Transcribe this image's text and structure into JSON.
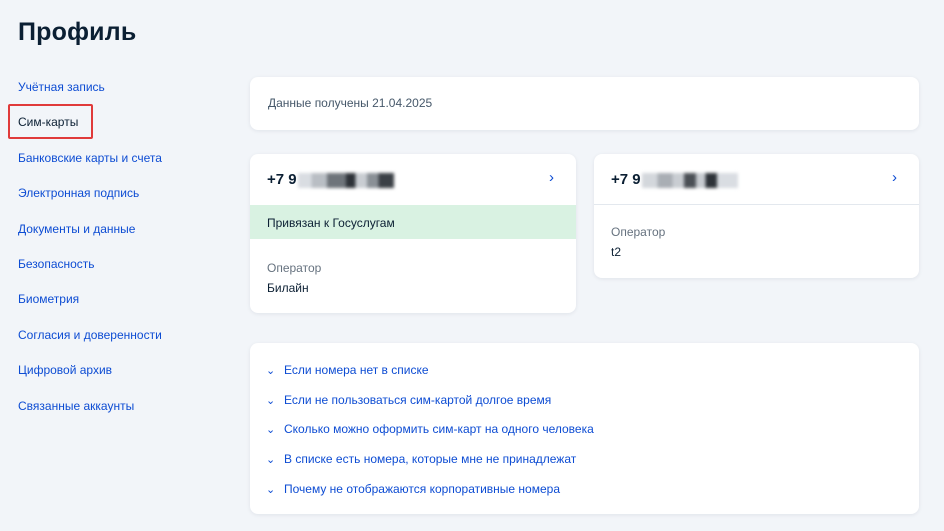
{
  "page": {
    "title": "Профиль"
  },
  "sidebar": {
    "items": [
      {
        "label": "Учётная запись"
      },
      {
        "label": "Сим-карты"
      },
      {
        "label": "Банковские карты и счета"
      },
      {
        "label": "Электронная подпись"
      },
      {
        "label": "Документы и данные"
      },
      {
        "label": "Безопасность"
      },
      {
        "label": "Биометрия"
      },
      {
        "label": "Согласия и доверенности"
      },
      {
        "label": "Цифровой архив"
      },
      {
        "label": "Связанные аккаунты"
      }
    ],
    "active": "Сим-карты"
  },
  "info": {
    "text": "Данные получены 21.04.2025"
  },
  "sims": [
    {
      "number_prefix": "+7 9",
      "bound_text": "Привязан к Госуслугам",
      "operator_label": "Оператор",
      "operator": "Билайн"
    },
    {
      "number_prefix": "+7 9",
      "operator_label": "Оператор",
      "operator": "t2"
    }
  ],
  "faq": [
    {
      "label": "Если номера нет в списке"
    },
    {
      "label": "Если не пользоваться сим-картой долгое время"
    },
    {
      "label": "Сколько можно оформить сим-карт на одного человека"
    },
    {
      "label": "В списке есть номера, которые мне не принадлежат"
    },
    {
      "label": "Почему не отображаются корпоративные номера"
    }
  ],
  "colors": {
    "link": "#0d4cd3",
    "text": "#0b1f33",
    "background": "#f2f5f9",
    "bound_banner": "#d9f2e2",
    "active_frame": "#e03a3a"
  },
  "icons": {
    "sim_open": "chevron-right-icon",
    "faq_expand": "chevron-down-icon"
  }
}
